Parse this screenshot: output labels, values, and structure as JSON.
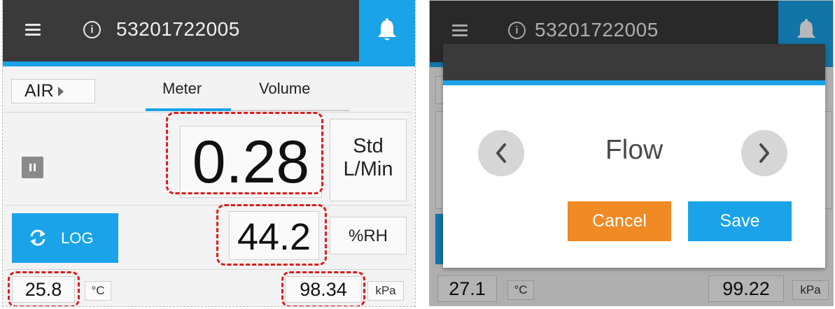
{
  "colors": {
    "topbar": "#3a3a3a",
    "accent": "#1aa3e8",
    "cancel": "#f08a24",
    "highlight": "#e01b1b"
  },
  "left_screen": {
    "header": {
      "menu_icon": "hamburger-menu-icon",
      "info_icon": "info-icon",
      "device_id": "53201722005",
      "bell_icon": "bell-icon"
    },
    "mode_selector": {
      "label": "AIR",
      "icon": "play-triangle-icon"
    },
    "tabs": [
      {
        "label": "Meter",
        "active": true
      },
      {
        "label": "Volume",
        "active": false
      }
    ],
    "pause_icon": "pause-icon",
    "flow": {
      "value": "0.28",
      "unit_line1": "Std",
      "unit_line2": "L/Min"
    },
    "log_button": {
      "label": "LOG",
      "icon": "refresh-arrows-icon"
    },
    "humidity": {
      "value": "44.2",
      "unit": "%RH"
    },
    "temperature": {
      "value": "25.8",
      "unit": "°C"
    },
    "pressure": {
      "value": "98.34",
      "unit": "kPa"
    }
  },
  "right_screen": {
    "header": {
      "device_id": "53201722005"
    },
    "dialog": {
      "prev_icon": "chevron-left-icon",
      "next_icon": "chevron-right-icon",
      "selection": "Flow",
      "cancel_label": "Cancel",
      "save_label": "Save"
    },
    "temperature": {
      "value": "27.1",
      "unit": "°C"
    },
    "pressure": {
      "value": "99.22",
      "unit": "kPa"
    }
  }
}
